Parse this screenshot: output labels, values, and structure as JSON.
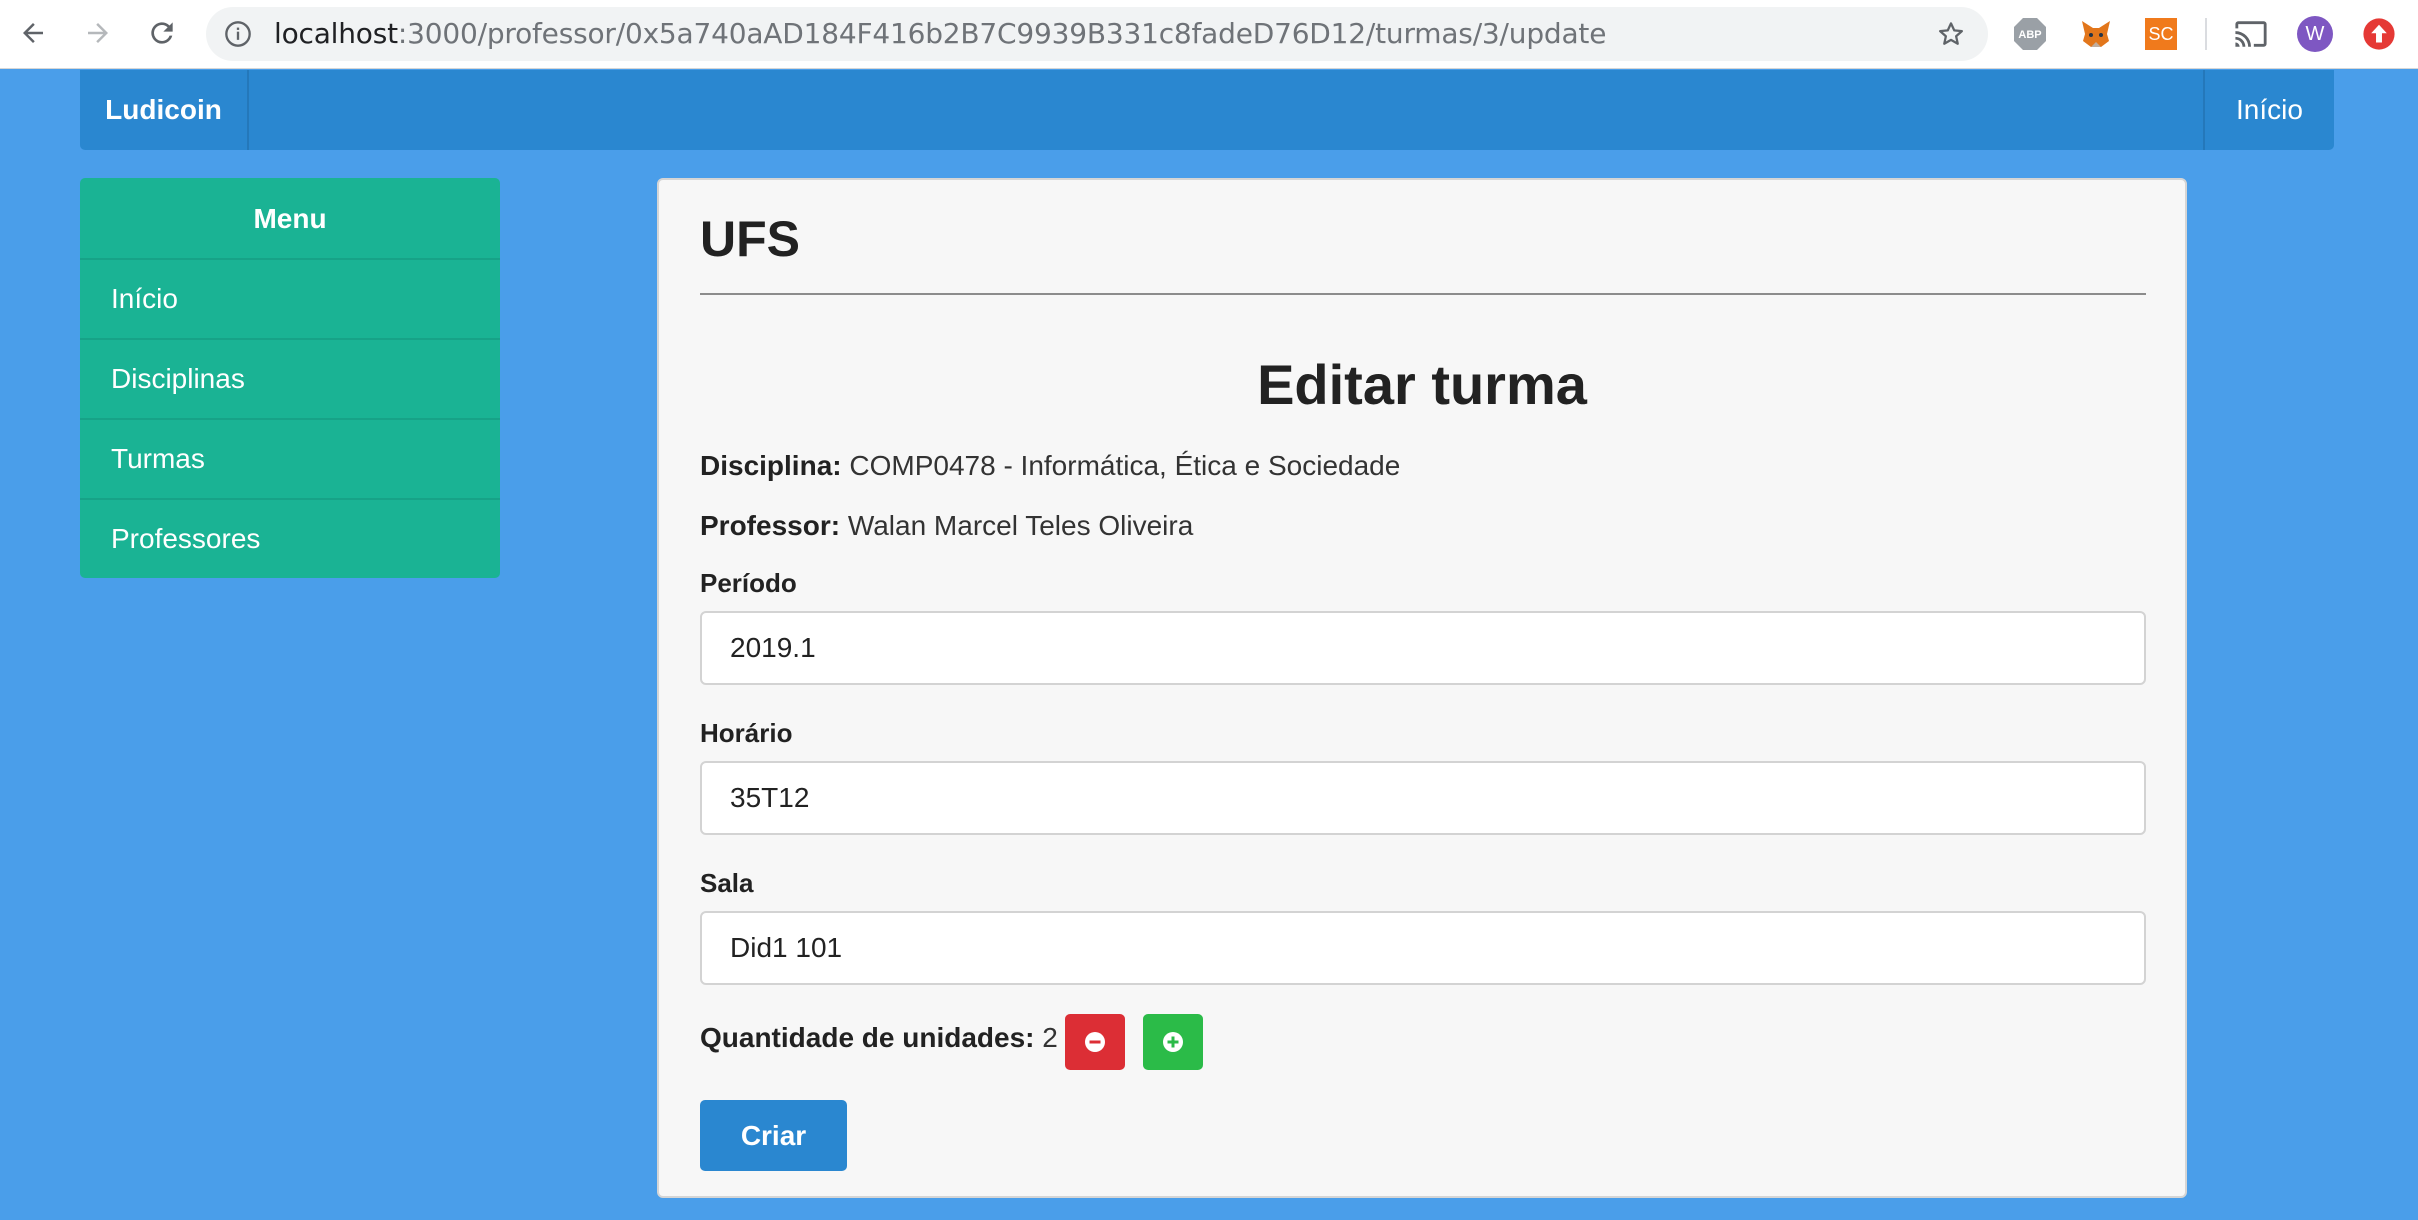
{
  "browser": {
    "url_host": "localhost",
    "url_path": ":3000/professor/0x5a740aAD184F416b2B7C9939B331c8fadeD76D12/turmas/3/update",
    "extensions": {
      "abp_label": "ABP",
      "sc_label": "SC",
      "profile_initial": "W"
    }
  },
  "navbar": {
    "brand": "Ludicoin",
    "home_link": "Início"
  },
  "sidebar": {
    "title": "Menu",
    "items": [
      {
        "label": "Início"
      },
      {
        "label": "Disciplinas"
      },
      {
        "label": "Turmas"
      },
      {
        "label": "Professores"
      }
    ]
  },
  "panel": {
    "title": "UFS",
    "form_title": "Editar turma",
    "disciplina_label": "Disciplina:",
    "disciplina_value": "COMP0478 - Informática, Ética e Sociedade",
    "professor_label": "Professor:",
    "professor_value": "Walan Marcel Teles Oliveira",
    "fields": {
      "periodo": {
        "label": "Período",
        "value": "2019.1"
      },
      "horario": {
        "label": "Horário",
        "value": "35T12"
      },
      "sala": {
        "label": "Sala",
        "value": "Did1 101"
      }
    },
    "quantity_label": "Quantidade de unidades:",
    "quantity_value": "2",
    "submit_label": "Criar"
  },
  "colors": {
    "page_bg": "#4a9eea",
    "navbar_bg": "#2a87d0",
    "sidebar_bg": "#1ab394",
    "remove_button": "#dc2e35",
    "add_button": "#2bbb48"
  }
}
